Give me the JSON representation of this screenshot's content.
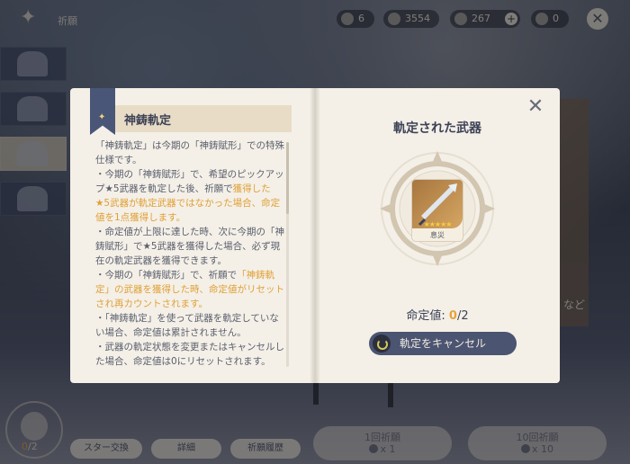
{
  "topbar": {
    "page_name": "祈願",
    "currencies": [
      {
        "icon": "fate-icon",
        "value": "6"
      },
      {
        "icon": "primogem-icon",
        "value": "3554"
      },
      {
        "icon": "crystal-icon",
        "value": "267"
      },
      {
        "icon": "masterless-icon",
        "value": "0"
      }
    ],
    "close_symbol": "✕"
  },
  "modal": {
    "left_title": "神鋳軌定",
    "paragraphs": [
      {
        "parts": [
          {
            "text": "「神鋳軌定」は今期の「神鋳賦形」での特殊仕様です。",
            "hl": false
          }
        ]
      },
      {
        "parts": [
          {
            "text": "・今期の「神鋳賦形」で、希望のピックアップ★5武器を軌定した後、祈願で",
            "hl": false
          },
          {
            "text": "獲得した★5武器が軌定武器ではなかった場合、命定値を1点獲得します。",
            "hl": true
          }
        ]
      },
      {
        "parts": [
          {
            "text": "・命定値が上限に達した時、次に今期の「神鋳賦形」で★5武器を獲得した場合、必ず現在の軌定武器を獲得できます。",
            "hl": false
          }
        ]
      },
      {
        "parts": [
          {
            "text": "・今期の「神鋳賦形」で、祈願で",
            "hl": false
          },
          {
            "text": "「神鋳軌定」の武器を獲得した時、命定値がリセットされ再カウントされます。",
            "hl": true
          }
        ]
      },
      {
        "parts": [
          {
            "text": "・「神鋳軌定」を使って武器を軌定していない場合、命定値は累計されません。",
            "hl": false
          }
        ]
      },
      {
        "parts": [
          {
            "text": "・武器の軌定状態を変更またはキャンセルした場合、命定値は0にリセットされます。",
            "hl": false
          }
        ]
      }
    ],
    "right_title": "軌定された武器",
    "weapon": {
      "name": "息災",
      "stars": "★★★★★",
      "rarity": 5
    },
    "points_label": "命定値:",
    "points_current": "0",
    "points_max": "/2",
    "cancel_label": "軌定をキャンセル",
    "close_symbol": "✕"
  },
  "bottom": {
    "fate_current": "0",
    "fate_max": "/2",
    "buttons": [
      "スター交換",
      "詳細",
      "祈願履歴"
    ],
    "wish1": {
      "label": "1回祈願",
      "cost": "x 1"
    },
    "wish10": {
      "label": "10回祈願",
      "cost": "x 10"
    }
  },
  "background": {
    "right_card_text": "など"
  },
  "colors": {
    "accent": "#e6a33c",
    "button": "#4b5470",
    "paper": "#f4f0e8",
    "title": "#3d4256"
  }
}
